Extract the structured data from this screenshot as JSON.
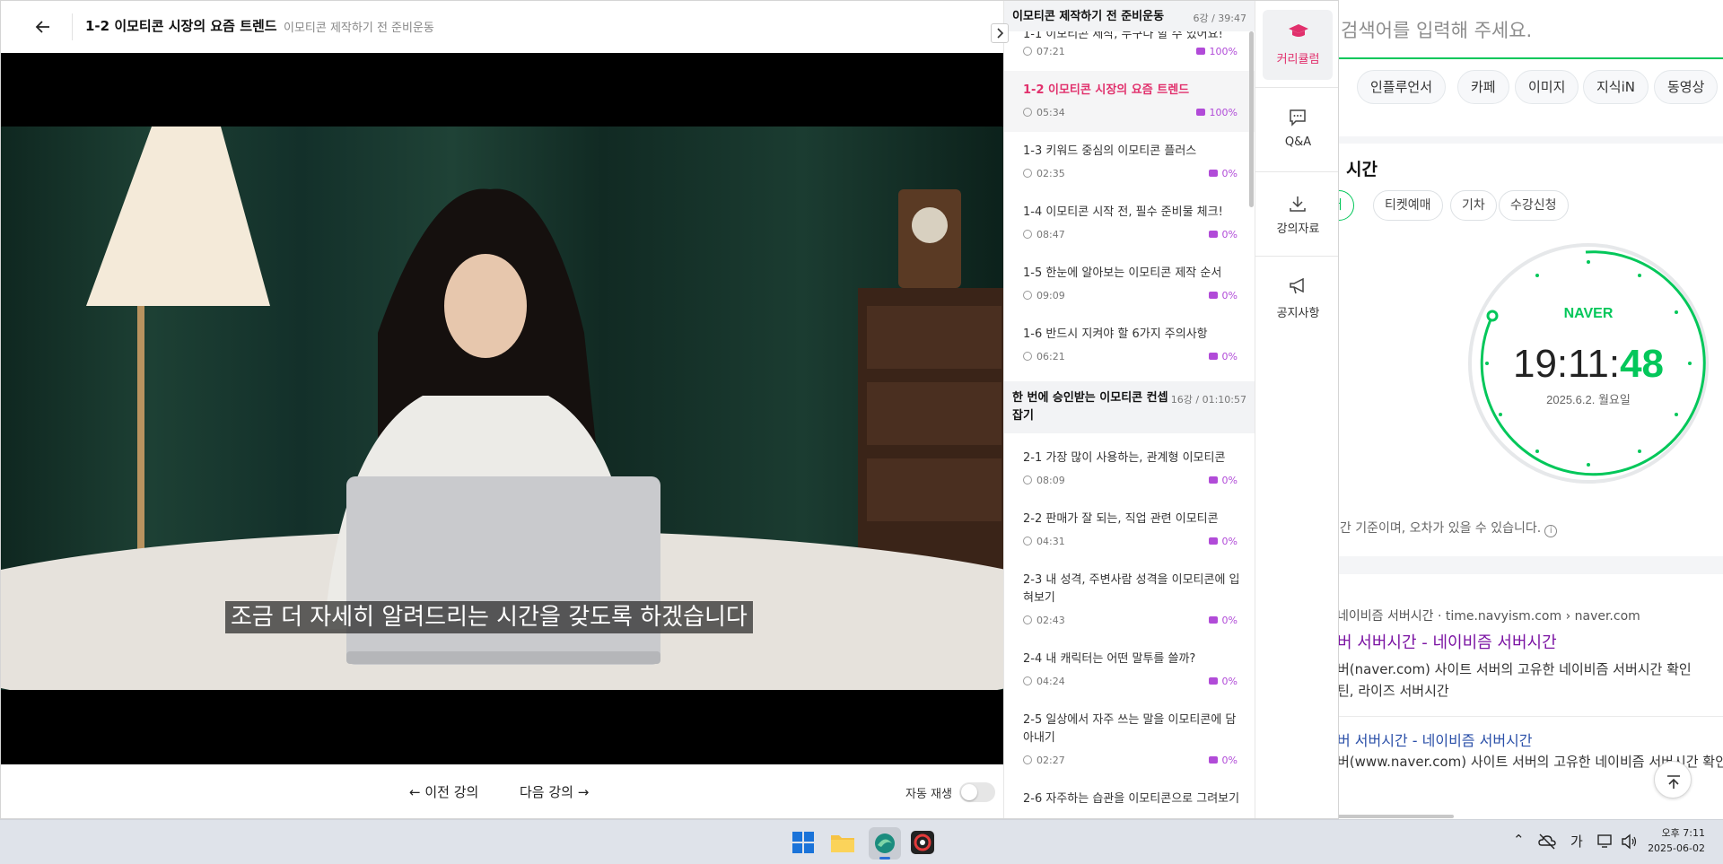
{
  "player": {
    "title": "1-2 이모티콘 시장의 요즘 트렌드",
    "subtitle_course": "이모티콘 제작하기 전 준비운동",
    "caption": "조금 더 자세히 알려드리는 시간을 갖도록 하겠습니다",
    "prev_label": "이전 강의",
    "next_label": "다음 강의",
    "autoplay_label": "자동 재생"
  },
  "curriculum": {
    "sections": [
      {
        "name": "이모티콘 제작하기 전 준비운동",
        "meta": "6강 / 39:47"
      },
      {
        "name": "한 번에 승인받는 이모티콘 컨셉잡기",
        "meta": "16강 / 01:10:57"
      }
    ],
    "lectures": [
      {
        "title": "1-1 이모티콘 제작, 누구나 할 수 있어요!",
        "duration": "07:21",
        "progress": "100%"
      },
      {
        "title": "1-2 이모티콘 시장의 요즘 트렌드",
        "duration": "05:34",
        "progress": "100%"
      },
      {
        "title": "1-3 키워드 중심의 이모티콘 플러스",
        "duration": "02:35",
        "progress": "0%"
      },
      {
        "title": "1-4 이모티콘 시작 전, 필수 준비물 체크!",
        "duration": "08:47",
        "progress": "0%"
      },
      {
        "title": "1-5 한눈에 알아보는 이모티콘 제작 순서",
        "duration": "09:09",
        "progress": "0%"
      },
      {
        "title": "1-6 반드시 지켜야 할 6가지 주의사항",
        "duration": "06:21",
        "progress": "0%"
      },
      {
        "title": "2-1 가장 많이 사용하는, 관계형 이모티콘",
        "duration": "08:09",
        "progress": "0%"
      },
      {
        "title": "2-2 판매가 잘 되는, 직업 관련 이모티콘",
        "duration": "04:31",
        "progress": "0%"
      },
      {
        "title": "2-3 내 성격, 주변사람 성격을 이모티콘에 입혀보기",
        "duration": "02:43",
        "progress": "0%"
      },
      {
        "title": "2-4 내 캐릭터는 어떤 말투를 쓸까?",
        "duration": "04:24",
        "progress": "0%"
      },
      {
        "title": "2-5 일상에서 자주 쓰는 말을 이모티콘에 담아내기",
        "duration": "02:27",
        "progress": "0%"
      },
      {
        "title": "2-6 자주하는 습관을 이모티콘으로 그려보기",
        "duration": "",
        "progress": ""
      }
    ]
  },
  "tools": {
    "curriculum": "커리큘럼",
    "qa": "Q&A",
    "materials": "강의자료",
    "notice": "공지사항"
  },
  "naver": {
    "search_placeholder": "검색어를 입력해 주세요.",
    "tabs": [
      "인플루언서",
      "카페",
      "이미지",
      "지식iN",
      "동영상"
    ],
    "card_title": "시간",
    "chips": [
      "버",
      "티켓예매",
      "기차",
      "수강신청"
    ],
    "clock_brand": "NAVER",
    "clock_hm": "19:11:",
    "clock_sec": "48",
    "clock_date": "2025.6.2. 월요일",
    "note": "시간 기준이며, 오차가 있을 수 있습니다.",
    "result1_source": "네이비즘 서버시간 · time.navyism.com › naver.com",
    "result1_title": "버 서버시간 - 네이비즘 서버시간",
    "result1_desc1": "버(naver.com) 사이트 서버의 고유한 네이비즘 서버시간 확인",
    "result1_desc2": "틴, 라이즈 서버시간",
    "result2_title": "버 서버시간 - 네이비즘 서버시간",
    "result2_desc": "버(www.naver.com) 사이트 서버의 고유한 네이비즘 서버시간 확인"
  },
  "taskbar": {
    "ime": "가",
    "time": "오후 7:11",
    "date": "2025-06-02"
  },
  "colors": {
    "accent_pink": "#e1306c",
    "progress_purple": "#b14bd8",
    "naver_green": "#03c75a"
  }
}
